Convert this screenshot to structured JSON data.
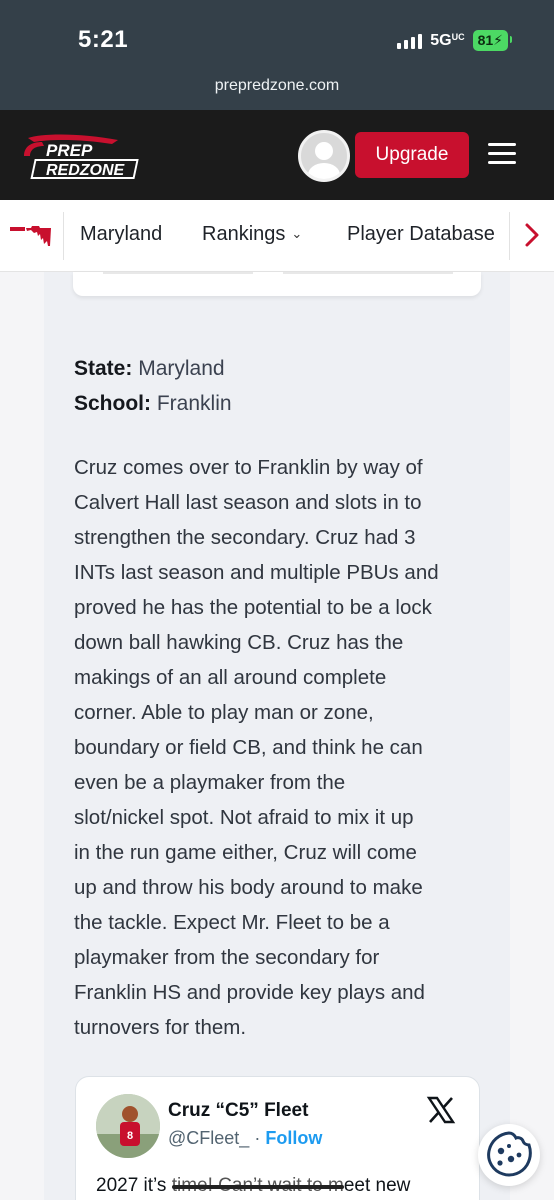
{
  "status_bar": {
    "time": "5:21",
    "network": "5G",
    "network_suffix": "UC",
    "battery": "81"
  },
  "browser": {
    "url": "prepredzone.com"
  },
  "header": {
    "logo_line1": "PREP",
    "logo_line2": "REDZONE",
    "upgrade_label": "Upgrade",
    "accent_color": "#c8102e"
  },
  "nav": {
    "items": [
      {
        "label": "Maryland"
      },
      {
        "label": "Rankings"
      },
      {
        "label": "Player Database"
      }
    ]
  },
  "article": {
    "state_label": "State:",
    "state_value": "Maryland",
    "school_label": "School:",
    "school_value": "Franklin",
    "body": [
      "Cruz comes over to Franklin by way of",
      "Calvert Hall last season and slots in to",
      "strengthen the secondary. Cruz had 3",
      "INTs last season and multiple PBUs and",
      "proved he has the potential to be a lock",
      "down ball hawking CB. Cruz has the",
      "makings of an all around complete",
      "corner. Able to play man or zone,",
      "boundary or field CB, and think he can",
      "even be a playmaker from the",
      "slot/nickel spot. Not afraid to mix it up",
      "in the run game either, Cruz will come",
      "up and throw his body around to make",
      "the tackle. Expect Mr. Fleet to be a",
      "playmaker from the secondary for",
      "Franklin HS and provide key plays and",
      "turnovers for them."
    ]
  },
  "tweet": {
    "name": "Cruz “C5” Fleet",
    "handle": "@CFleet_",
    "separator": "·",
    "follow_label": "Follow",
    "text_start": "2027 it’s ",
    "text_scribbled": "time! Can’t wait to m",
    "text_end": "eet new"
  }
}
